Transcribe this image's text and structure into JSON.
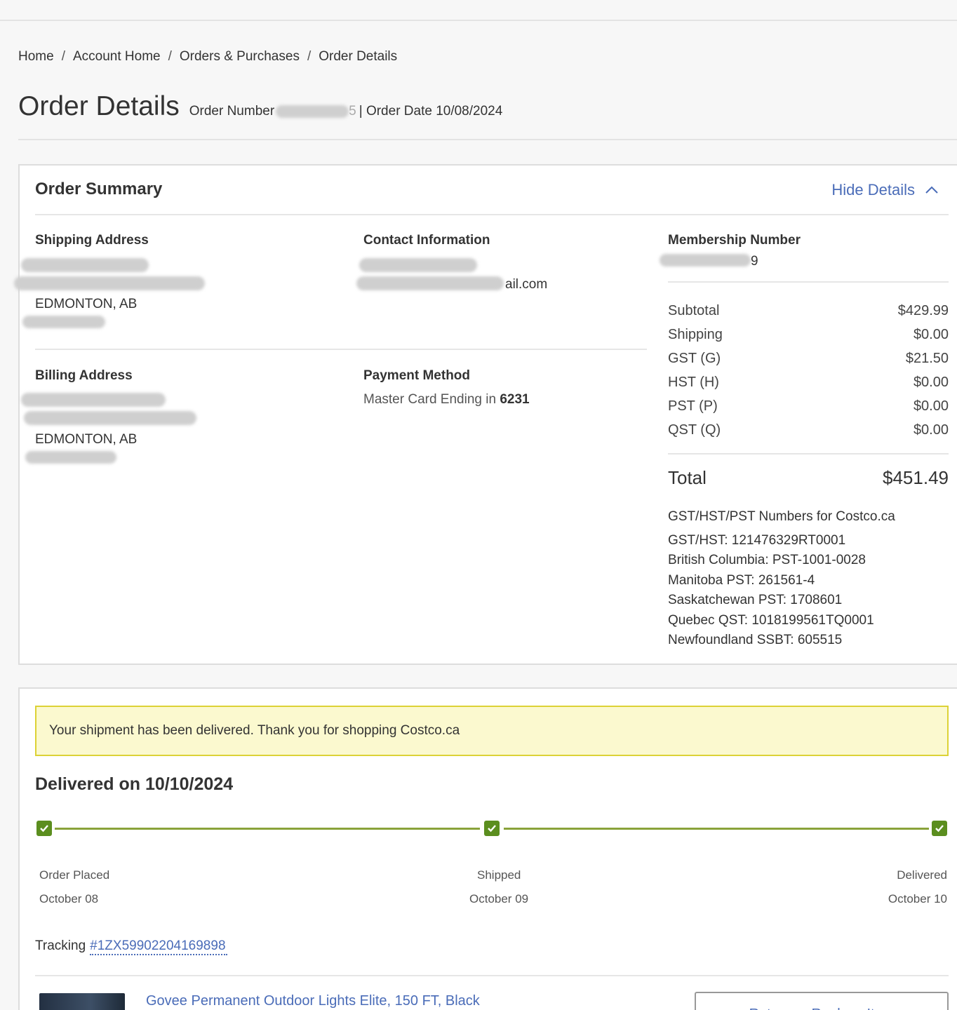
{
  "breadcrumb": {
    "items": [
      "Home",
      "Account Home",
      "Orders & Purchases",
      "Order Details"
    ],
    "separator": "/"
  },
  "header": {
    "title": "Order Details",
    "order_number_label": "Order Number",
    "order_number_suffix": "5",
    "order_date_text": "| Order Date 10/08/2024"
  },
  "summary": {
    "heading": "Order Summary",
    "hide_details": "Hide Details",
    "shipping_address": {
      "label": "Shipping Address",
      "city": "EDMONTON, AB"
    },
    "contact": {
      "label": "Contact Information",
      "email_suffix": "ail.com"
    },
    "billing_address": {
      "label": "Billing Address",
      "city": "EDMONTON, AB"
    },
    "payment": {
      "label": "Payment Method",
      "text": "Master Card Ending in",
      "last4": "6231"
    },
    "membership": {
      "label": "Membership Number",
      "suffix": "9"
    },
    "totals": [
      {
        "label": "Subtotal",
        "value": "$429.99"
      },
      {
        "label": "Shipping",
        "value": "$0.00"
      },
      {
        "label": "GST (G)",
        "value": "$21.50"
      },
      {
        "label": "HST (H)",
        "value": "$0.00"
      },
      {
        "label": "PST (P)",
        "value": "$0.00"
      },
      {
        "label": "QST (Q)",
        "value": "$0.00"
      }
    ],
    "total": {
      "label": "Total",
      "value": "$451.49"
    },
    "tax_numbers": [
      "GST/HST/PST Numbers for Costco.ca",
      "GST/HST: 121476329RT0001",
      "British Columbia: PST-1001-0028",
      "Manitoba PST: 261561-4",
      "Saskatchewan PST: 1708601",
      "Quebec QST: 1018199561TQ0001",
      "Newfoundland SSBT: 605515"
    ]
  },
  "shipment": {
    "alert": "Your shipment has been delivered. Thank you for shopping Costco.ca",
    "heading": "Delivered on 10/10/2024",
    "steps": [
      {
        "label": "Order Placed",
        "date": "October 08"
      },
      {
        "label": "Shipped",
        "date": "October 09"
      },
      {
        "label": "Delivered",
        "date": "October 10"
      }
    ],
    "tracking_label": "Tracking",
    "tracking_number": "#1ZX59902204169898",
    "item_title": "Govee Permanent Outdoor Lights Elite, 150 FT, Black",
    "return_button": "Return or Replace Item"
  },
  "colors": {
    "link": "#4a6cb8",
    "progress": "#8aa33a",
    "check": "#5b8e1f",
    "alert_bg": "#fbf9cf",
    "alert_border": "#dcd236"
  }
}
